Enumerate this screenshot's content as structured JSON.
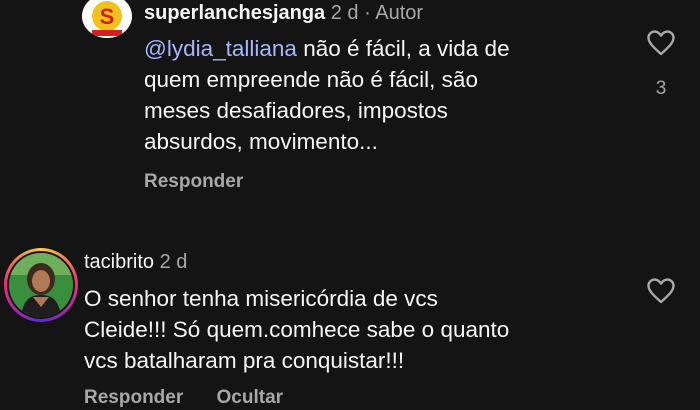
{
  "comments": [
    {
      "username": "superlanchesjanga",
      "time": "2 d",
      "separator": "·",
      "author_badge": "Autor",
      "mention": "@lydia_talliana",
      "lines": [
        " não é fácil, a vida de",
        "quem empreende não é fácil, são",
        "meses desafiadores, impostos",
        "absurdos, movimento..."
      ],
      "reply_label": "Responder",
      "like_count": "3",
      "avatar_logo_text": "S"
    },
    {
      "username": "tacibrito",
      "time": "2 d",
      "lines": [
        "O senhor tenha misericórdia de vcs",
        "Cleide!!! Só quem.comhece sabe o quanto",
        "vcs batalharam pra conquistar!!!"
      ],
      "reply_label": "Responder",
      "hide_label": "Ocultar"
    }
  ],
  "colors": {
    "background": "#141414",
    "text": "#f5f5f5",
    "muted": "#a8a8a8",
    "mention": "#a6b6ff"
  },
  "icons": {
    "like": "heart-outline-icon"
  }
}
